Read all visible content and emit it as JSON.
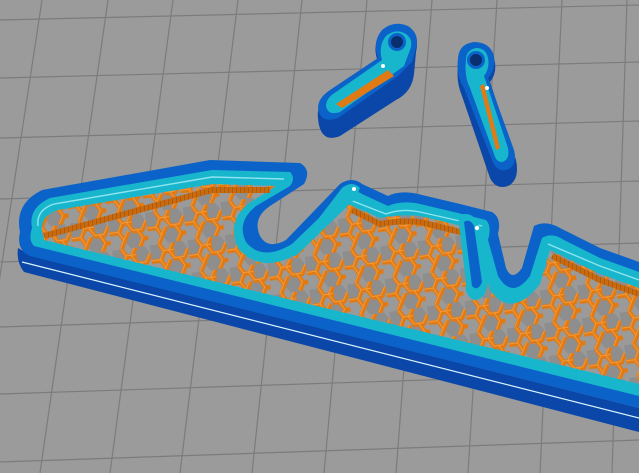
{
  "viewport": {
    "view": "slicer-layer-preview",
    "colors": {
      "bed": "#9b9b9b",
      "bed_grid": "#7c7c7c",
      "wall_side": "#0a47a8",
      "outer_perimeter": "#0b63c9",
      "inner_perimeter": "#18b6cc",
      "perimeter_highlight": "#8fe3ee",
      "infill": "#e27a14",
      "infill_dark": "#b85a05"
    },
    "objects": [
      {
        "id": "main-body",
        "kind": "sliced-part",
        "infill_pattern": "honeycomb"
      },
      {
        "id": "loose-piece-left",
        "kind": "sliced-part"
      },
      {
        "id": "loose-piece-right",
        "kind": "sliced-part"
      }
    ]
  }
}
